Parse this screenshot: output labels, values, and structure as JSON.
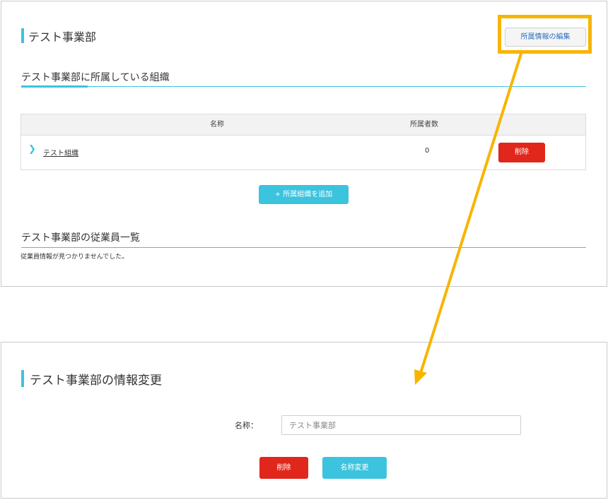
{
  "top_panel": {
    "title": "テスト事業部",
    "edit_button": "所属情報の編集",
    "orgs_section_title": "テスト事業部に所属している組織",
    "table": {
      "headers": [
        "名称",
        "所属者数"
      ],
      "rows": [
        {
          "name": "テスト組織",
          "count": "0",
          "delete_label": "削除"
        }
      ]
    },
    "add_org_button": "+ 所属組織を追加",
    "employees_section_title": "テスト事業部の従業員一覧",
    "employees_empty_message": "従業員情報が見つかりませんでした。"
  },
  "bottom_panel": {
    "title": "テスト事業部の情報変更",
    "name_label": "名称：",
    "name_placeholder": "テスト事業部",
    "delete_button": "削除",
    "rename_button": "名称変更"
  },
  "colors": {
    "accent": "#3cc3de",
    "danger": "#e1261c",
    "highlight": "#f7b500"
  },
  "icons": {
    "row_expand": "chevron-right-icon",
    "callout": "arrow-icon"
  }
}
